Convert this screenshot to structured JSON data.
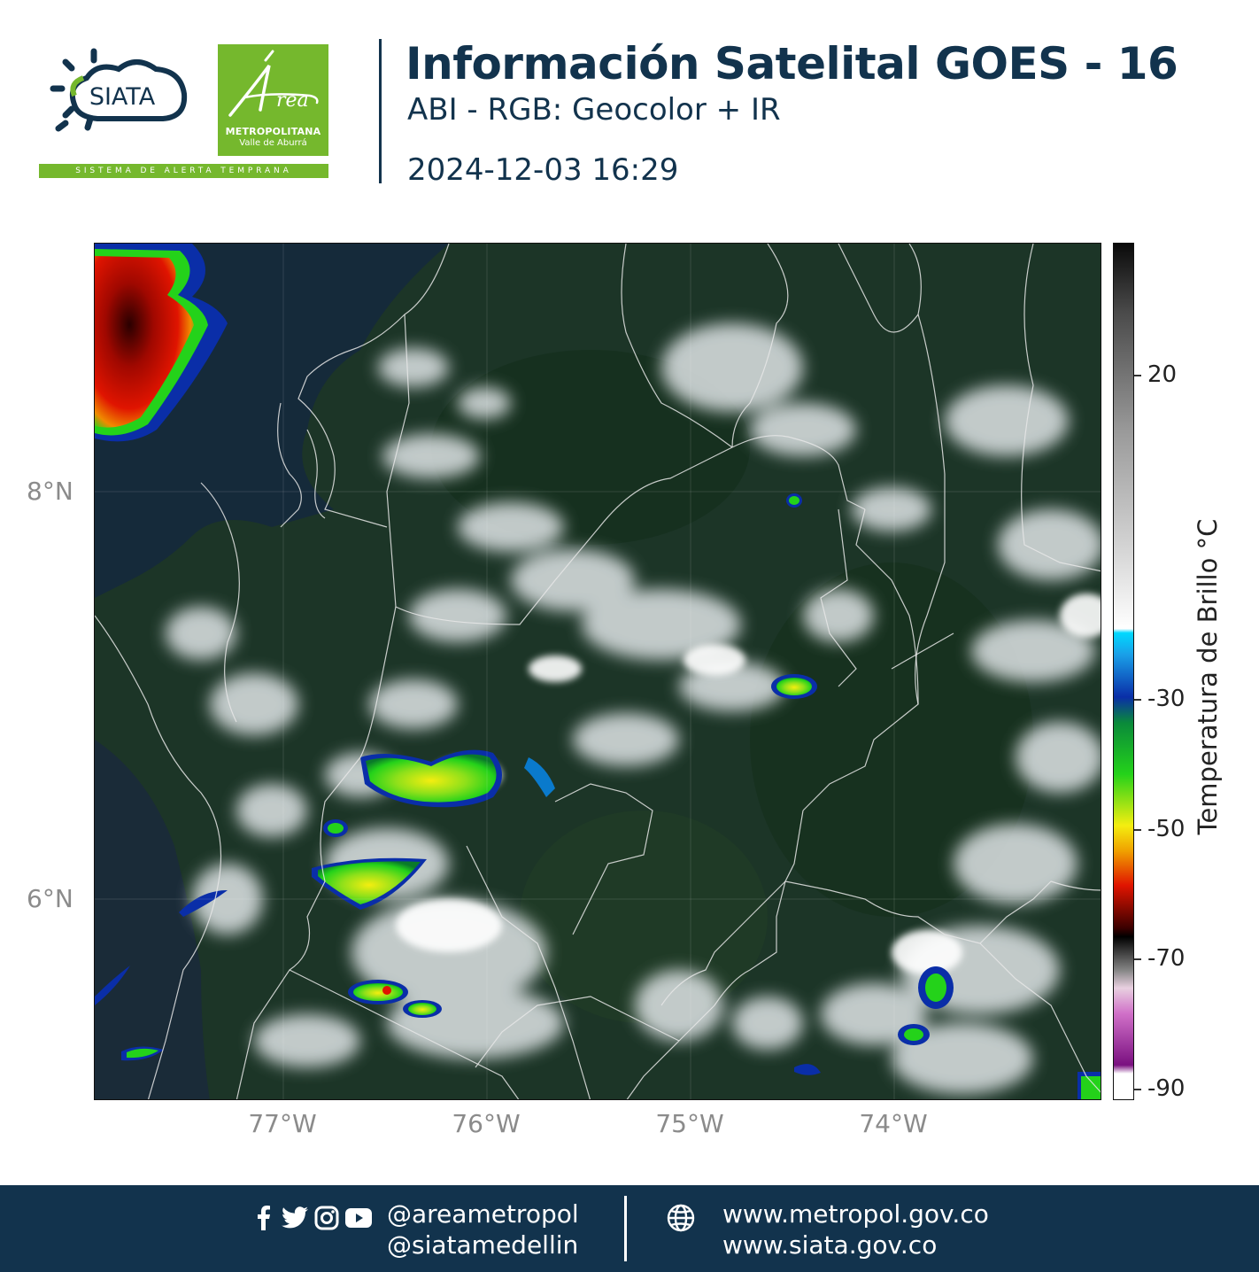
{
  "header": {
    "siata_logo_text": "SIATA",
    "siata_strip_text": "SISTEMA DE ALERTA TEMPRANA",
    "area_logo_script": "Área",
    "area_logo_line1": "METROPOLITANA",
    "area_logo_line2": "Valle de Aburrá",
    "title": "Información Satelital GOES - 16",
    "subtitle": "ABI - RGB: Geocolor + IR",
    "timestamp": "2024-12-03 16:29"
  },
  "map": {
    "lat_labels": [
      "8°N",
      "6°N"
    ],
    "lon_labels": [
      "77°W",
      "76°W",
      "75°W",
      "74°W"
    ],
    "lat_values": [
      8,
      6
    ],
    "lon_values": [
      -77,
      -76,
      -75,
      -74
    ],
    "extent": {
      "lon_min": -77.93,
      "lon_max": -72.98,
      "lat_min": 5.03,
      "lat_max": 9.24
    }
  },
  "colorbar": {
    "title": "Temperatura de Brillo  °C",
    "ticks": [
      "20",
      "-30",
      "-50",
      "-70",
      "-90"
    ],
    "tick_values": [
      20,
      -30,
      -50,
      -70,
      -90
    ],
    "range": [
      -92,
      32
    ],
    "colors": {
      "warm_top": "#0a0a0a",
      "mid_gray": "#9a9a9a",
      "white": "#ffffff",
      "cyan": "#00d8ff",
      "blue": "#0a2ea8",
      "green": "#24d21a",
      "yellow": "#f4ee10",
      "red": "#e01400",
      "dark_red": "#3a0000",
      "magenta": "#d070c8",
      "purple": "#7a1080"
    }
  },
  "footer": {
    "social_icons": [
      "facebook-icon",
      "twitter-icon",
      "instagram-icon",
      "youtube-icon"
    ],
    "handles": [
      "@areametropol",
      "@siatamedellin"
    ],
    "urls": [
      "www.metropol.gov.co",
      "www.siata.gov.co"
    ],
    "background": "#12334d"
  }
}
